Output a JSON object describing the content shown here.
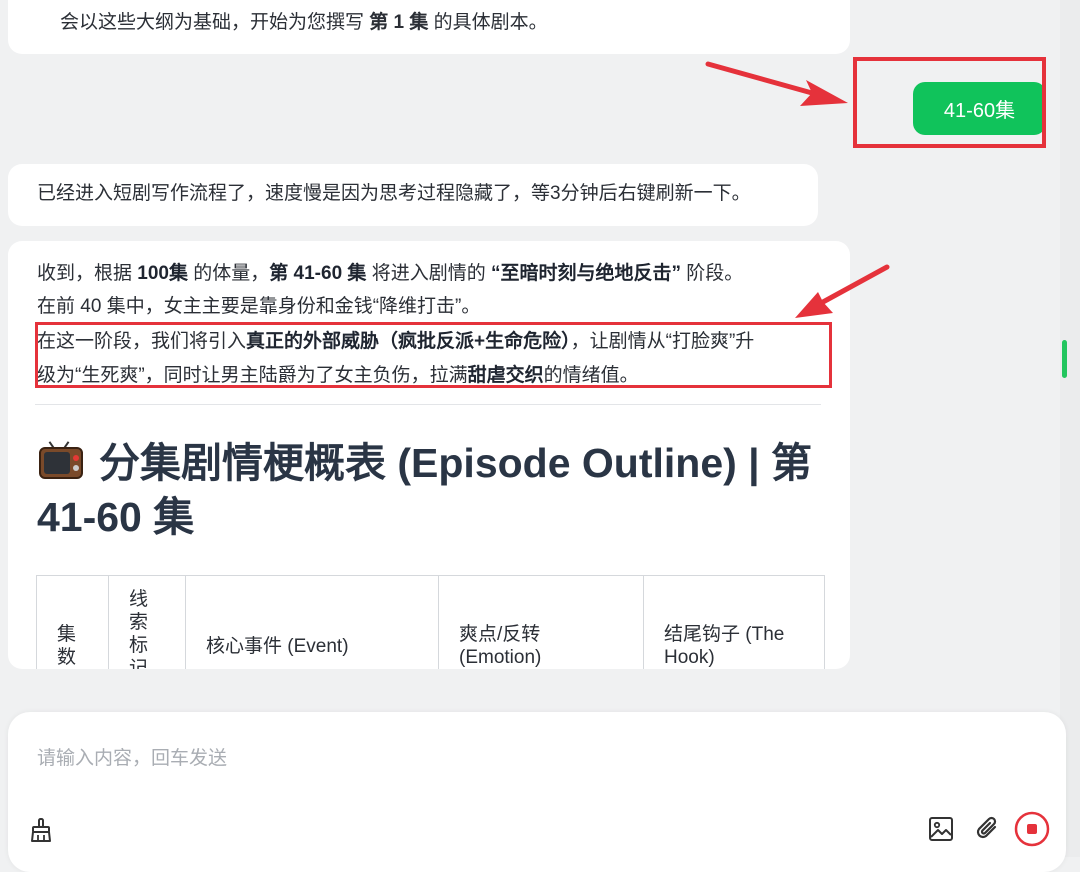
{
  "chat": {
    "msg1_text": "会以这些大纲为基础，开始为您撰写 ",
    "msg1_bold": "第 1 集",
    "msg1_tail": " 的具体剧本。",
    "user_message": "41-60集",
    "msg2_text": "已经进入短剧写作流程了，速度慢是因为思考过程隐藏了，等3分钟后右键刷新一下。",
    "msg3": {
      "l1_a": "收到，根据 ",
      "l1_b": "100集",
      "l1_c": " 的体量，",
      "l1_d": "第 41-60 集",
      "l1_e": " 将进入剧情的 ",
      "l1_f": "“至暗时刻与绝地反击”",
      "l1_g": " 阶段。",
      "l2": "在前 40 集中，女主主要是靠身份和金钱“降维打击”。",
      "l3_a": "在这一阶段，我们将引入",
      "l3_b": "真正的外部威胁（疯批反派+生命危险）",
      "l3_c": "，让剧情从“打脸爽”升",
      "l4_a": "级为“生死爽”，同时让男主陆爵为了女主负伤，拉满",
      "l4_b": "甜虐交织",
      "l4_c": "的情绪值。",
      "heading": "分集剧情梗概表 (Episode Outline) | 第 41-60 集",
      "table_headers": [
        "集数",
        "线索标记",
        "核心事件 (Event)",
        "爽点/反转 (Emotion)",
        "结尾钩子 (The Hook)"
      ]
    }
  },
  "input": {
    "placeholder": "请输入内容，回车发送"
  },
  "icons": {
    "brush": "brush-icon",
    "image": "image-icon",
    "attach": "paperclip-icon",
    "stop": "stop-icon",
    "tv": "television-emoji"
  },
  "colors": {
    "accent": "#10c35b",
    "highlight": "#e5323b"
  }
}
